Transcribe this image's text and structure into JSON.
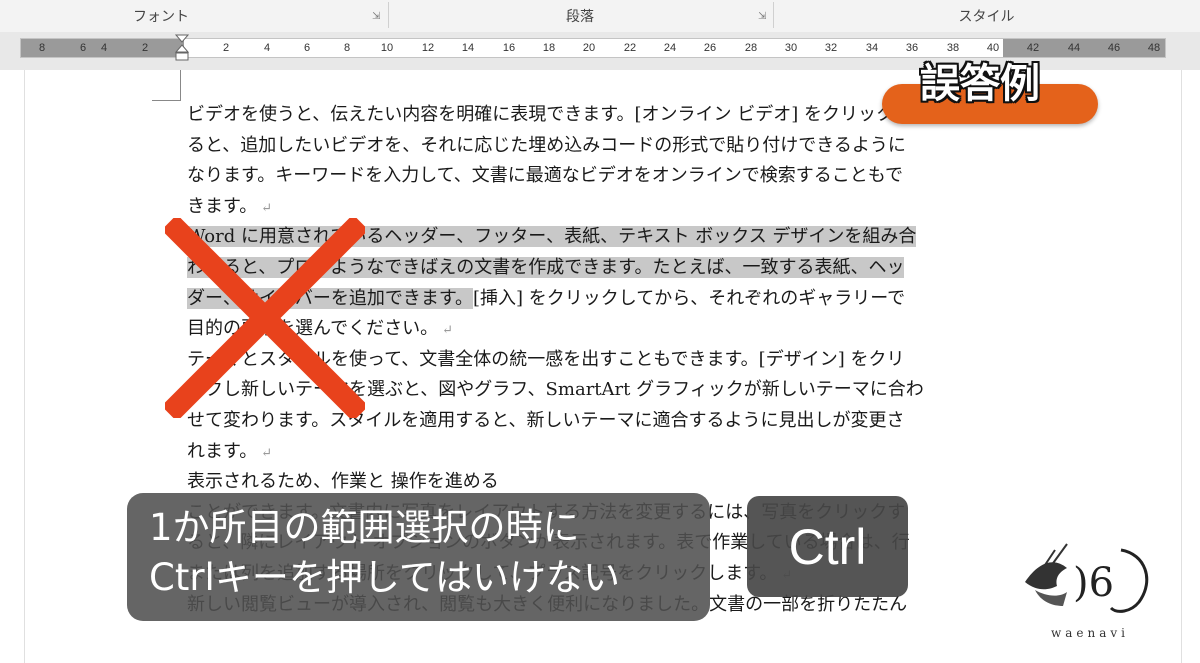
{
  "ribbon": {
    "groups": [
      {
        "label": "フォント"
      },
      {
        "label": "段落"
      },
      {
        "label": "スタイル"
      }
    ]
  },
  "ruler": {
    "left_ticks": [
      "8",
      "6",
      "4",
      "2"
    ],
    "right_ticks": [
      "2",
      "4",
      "6",
      "8",
      "10",
      "12",
      "14",
      "16",
      "18",
      "20",
      "22",
      "24",
      "26",
      "28",
      "30",
      "32",
      "34",
      "36",
      "38",
      "40",
      "42",
      "44",
      "46",
      "48"
    ]
  },
  "document": {
    "lines": [
      {
        "text": "ビデオを使うと、伝えたい内容を明確に表現できます。[オンライン ビデオ] をクリックす",
        "selected": false,
        "pilcrow": false
      },
      {
        "text": "ると、追加したいビデオを、それに応じた埋め込みコードの形式で貼り付けできるように",
        "selected": false,
        "pilcrow": false
      },
      {
        "text": "なります。キーワードを入力して、文書に最適なビデオをオンラインで検索することもで",
        "selected": false,
        "pilcrow": false
      },
      {
        "text": "きます。",
        "selected": false,
        "pilcrow": true
      },
      {
        "text": "Word に用意されているヘッダー、フッター、表紙、テキスト ボックス デザインを組み合",
        "selected": true,
        "pilcrow": false
      },
      {
        "text": "わせると、プロのようなできばえの文書を作成できます。たとえば、一致する表紙、ヘッ",
        "selected": true,
        "pilcrow": false
      },
      {
        "text": "ダー、サイドバーを追加できます。",
        "after": "[挿入] をクリックしてから、それぞれのギャラリーで",
        "selected": true,
        "pilcrow": false
      },
      {
        "text": "目的の要素を選んでください。",
        "selected": false,
        "pilcrow": true
      },
      {
        "text": "テーマとスタイルを使って、文書全体の統一感を出すこともできます。[デザイン] をクリ",
        "selected": false,
        "pilcrow": false
      },
      {
        "text": "ックし新しいテーマを選ぶと、図やグラフ、SmartArt グラフィックが新しいテーマに合わ",
        "selected": false,
        "pilcrow": false
      },
      {
        "text": "せて変わります。スタイルを適用すると、新しいテーマに適合するように見出しが変更さ",
        "selected": false,
        "pilcrow": false
      },
      {
        "text": "れます。",
        "selected": false,
        "pilcrow": true
      },
      {
        "text": "                                                    表示されるため、作業と 操作を進める",
        "selected": false,
        "pilcrow": false
      },
      {
        "text": "ことができます。文書内に写真をレイアウトする方法を変更するには、写真をクリックす",
        "selected": false,
        "pilcrow": false
      },
      {
        "text": "ると、隣にレイアウト オプションのボタンが表示されます。表で作業している場合は、行",
        "selected": false,
        "pilcrow": false
      },
      {
        "text": "または列を追加する場所をクリックして、プラス記号をクリックします。",
        "selected": false,
        "pilcrow": true
      },
      {
        "text": "新しい閲覧ビューが導入され、閲覧も大きく便利になりました。文書の一部を折りたたん",
        "selected": false,
        "pilcrow": false
      }
    ]
  },
  "overlay": {
    "tag": "誤答例",
    "caption_line1": "1か所目の範囲選択の時に",
    "caption_line2": "Ctrlキーを押してはいけない",
    "key": "Ctrl",
    "logo_text": "waenavi",
    "x_color": "#e8421c",
    "tag_color": "#e4621b"
  }
}
